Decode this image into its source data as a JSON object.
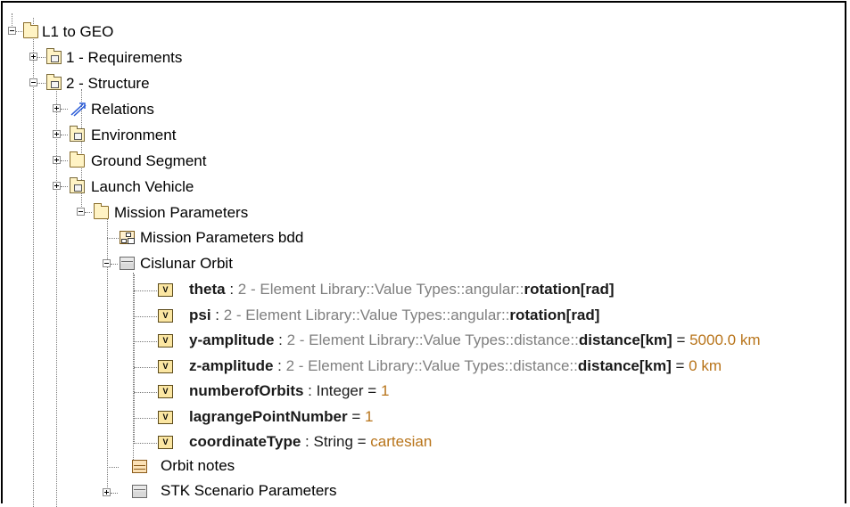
{
  "tree": {
    "root": {
      "label": "L1 to GEO"
    },
    "requirements": {
      "label": "1 - Requirements"
    },
    "structure": {
      "label": "2 - Structure"
    },
    "relations": {
      "label": "Relations"
    },
    "environment": {
      "label": "Environment"
    },
    "ground_segment": {
      "label": "Ground Segment"
    },
    "launch_vehicle": {
      "label": "Launch Vehicle"
    },
    "mission_parameters": {
      "label": "Mission Parameters"
    },
    "mission_parameters_bdd": {
      "label": "Mission Parameters bdd"
    },
    "cislunar_orbit": {
      "label": "Cislunar Orbit"
    },
    "properties": [
      {
        "name": "theta",
        "sep": " : ",
        "type_prefix": "2 - Element Library::Value Types::angular::",
        "type_name": "rotation[rad]",
        "eq": "",
        "value": ""
      },
      {
        "name": "psi",
        "sep": " : ",
        "type_prefix": "2 - Element Library::Value Types::angular::",
        "type_name": "rotation[rad]",
        "eq": "",
        "value": ""
      },
      {
        "name": "y-amplitude",
        "sep": " : ",
        "type_prefix": "2 - Element Library::Value Types::distance::",
        "type_name": "distance[km]",
        "eq": " = ",
        "value": "5000.0 km"
      },
      {
        "name": "z-amplitude",
        "sep": " : ",
        "type_prefix": "2 - Element Library::Value Types::distance::",
        "type_name": "distance[km]",
        "eq": " = ",
        "value": "0 km"
      },
      {
        "name": "numberofOrbits",
        "sep": " : ",
        "type_prefix": "",
        "type_name": "Integer",
        "eq": " = ",
        "value": "1"
      },
      {
        "name": "lagrangePointNumber",
        "sep": "",
        "type_prefix": "",
        "type_name": "",
        "eq": " = ",
        "value": "1"
      },
      {
        "name": "coordinateType",
        "sep": " : ",
        "type_prefix": "",
        "type_name": "String",
        "eq": " = ",
        "value": "cartesian"
      }
    ],
    "orbit_notes": {
      "label": "Orbit notes"
    },
    "stk_scenario": {
      "label": "STK Scenario Parameters"
    },
    "property_icon_letter": "V"
  },
  "icons": {
    "folder": "folder-icon",
    "package": "package-icon",
    "relations": "relations-icon",
    "block": "block-icon",
    "diagram": "bdd-diagram-icon",
    "property": "value-property-icon",
    "note": "note-icon"
  }
}
